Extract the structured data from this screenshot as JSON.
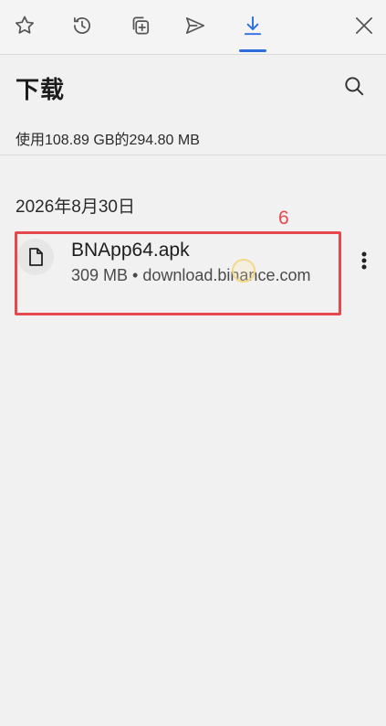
{
  "toolbar": {
    "tabs": [
      {
        "icon": "star-icon",
        "name": "favorites"
      },
      {
        "icon": "history-icon",
        "name": "history"
      },
      {
        "icon": "collections-icon",
        "name": "collections"
      },
      {
        "icon": "send-icon",
        "name": "share"
      },
      {
        "icon": "download-icon",
        "name": "downloads",
        "active": true
      }
    ],
    "close_icon": "close-icon",
    "active_color": "#2f6fdd"
  },
  "header": {
    "title": "下载",
    "search_icon": "search-icon"
  },
  "storage": {
    "text": "使用108.89 GB的294.80 MB"
  },
  "downloads": {
    "groups": [
      {
        "date": "2026年8月30日",
        "items": [
          {
            "name": "BNApp64.apk",
            "meta": "309 MB • download.binance.com"
          }
        ]
      }
    ]
  },
  "annotation": {
    "label": "6",
    "color": "#e5484d"
  }
}
